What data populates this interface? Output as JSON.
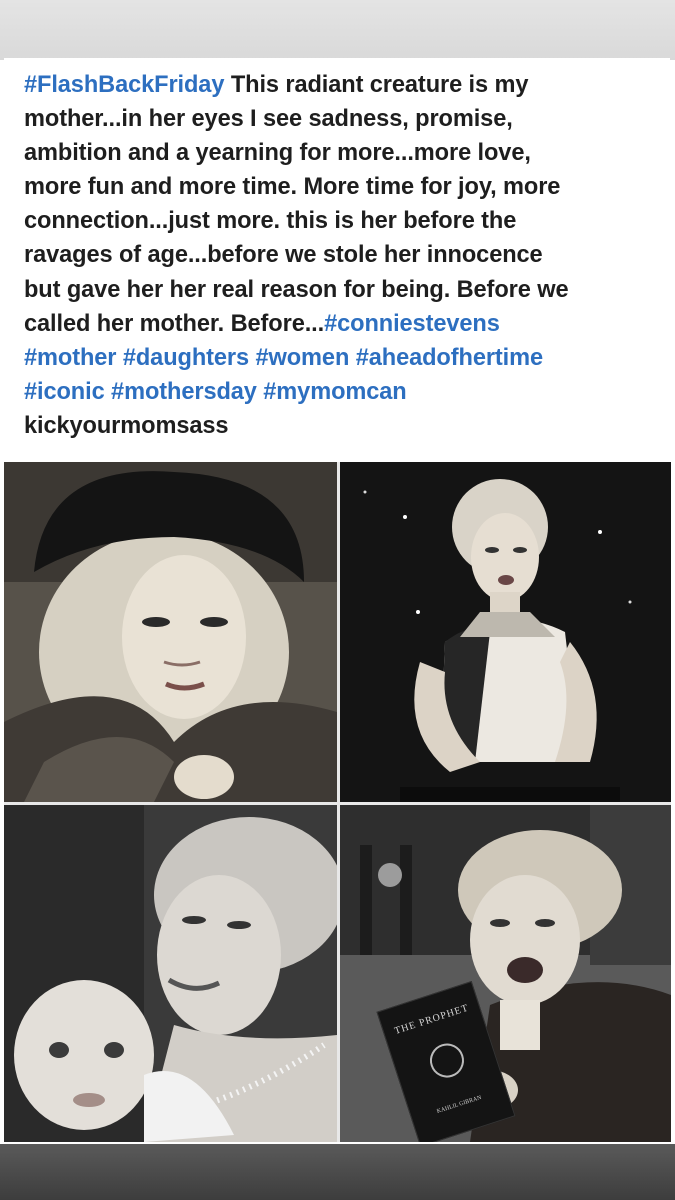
{
  "post": {
    "caption_lines": [
      [
        {
          "t": "#FlashBackFriday",
          "tag": true
        },
        {
          "t": " This radiant creature is my",
          "tag": false
        }
      ],
      [
        {
          "t": "mother...in her eyes I see sadness, promise,",
          "tag": false
        }
      ],
      [
        {
          "t": "ambition and a yearning for more...more love,",
          "tag": false
        }
      ],
      [
        {
          "t": "more fun and more time. More time for joy, more",
          "tag": false
        }
      ],
      [
        {
          "t": "connection...just more. this is her before the",
          "tag": false
        }
      ],
      [
        {
          "t": "ravages of age...before we stole her innocence",
          "tag": false
        }
      ],
      [
        {
          "t": "but gave her her real reason for being. Before we",
          "tag": false
        }
      ],
      [
        {
          "t": "called her mother. Before...",
          "tag": false
        },
        {
          "t": "#conniestevens",
          "tag": true
        }
      ],
      [
        {
          "t": "#mother #daughters #women #aheadofhertime",
          "tag": true
        }
      ],
      [
        {
          "t": "#iconic #mothersday #mymomcan",
          "tag": true
        }
      ],
      [
        {
          "t": "kickyourmomsass",
          "tag": false
        }
      ]
    ],
    "hashtag_color": "#2d6fc0",
    "text_color": "#1e1e1e"
  },
  "photos": {
    "book_title": "THE PROPHET",
    "book_author": "KAHLIL GIBRAN"
  }
}
